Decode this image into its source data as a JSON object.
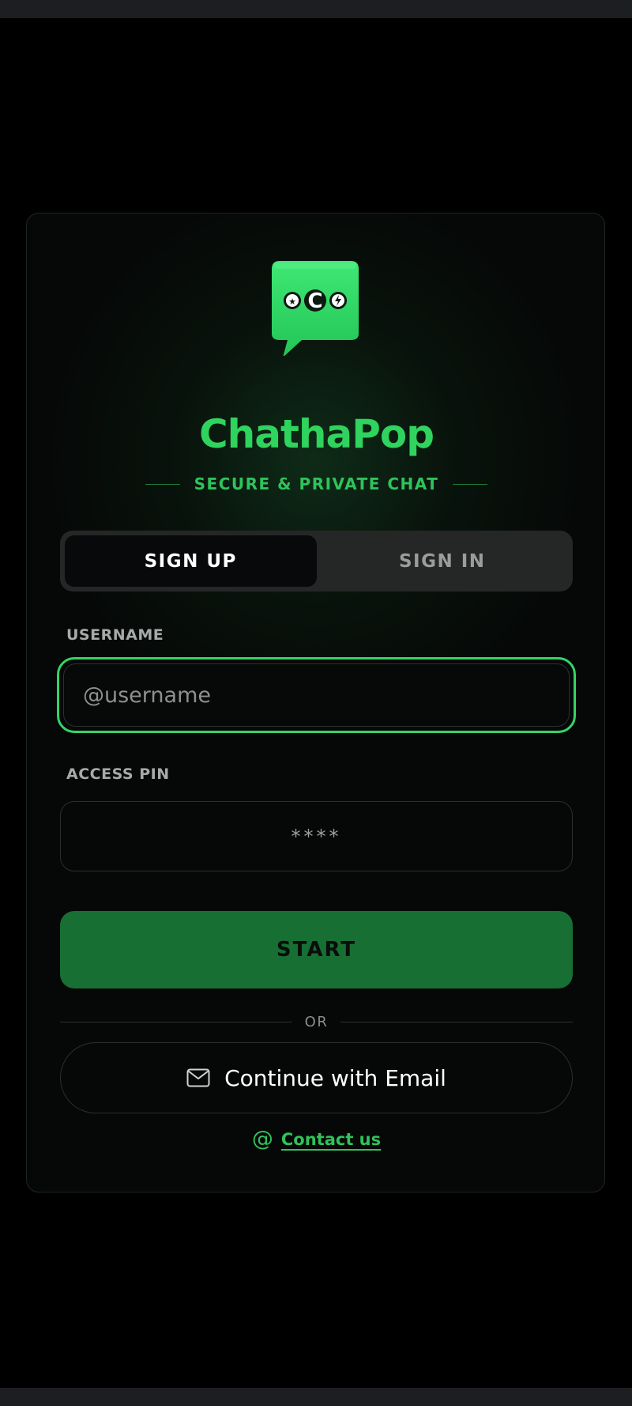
{
  "app": {
    "name": "ChathaPop",
    "tagline": "SECURE & PRIVATE CHAT",
    "logo_icon": "chat-bubble-logo-icon",
    "accent_color": "#2fd35d"
  },
  "tabs": [
    {
      "label": "SIGN UP",
      "active": true
    },
    {
      "label": "SIGN IN",
      "active": false
    }
  ],
  "form": {
    "username_label": "USERNAME",
    "username_placeholder": "@username",
    "username_value": "",
    "pin_label": "ACCESS PIN",
    "pin_placeholder": "****",
    "pin_value": "",
    "start_label": "START",
    "start_color": "#176f33"
  },
  "divider": {
    "label": "OR"
  },
  "email_button": {
    "label": "Continue with Email",
    "icon": "mail-icon"
  },
  "contact": {
    "icon_glyph": "@",
    "label": "Contact us"
  }
}
